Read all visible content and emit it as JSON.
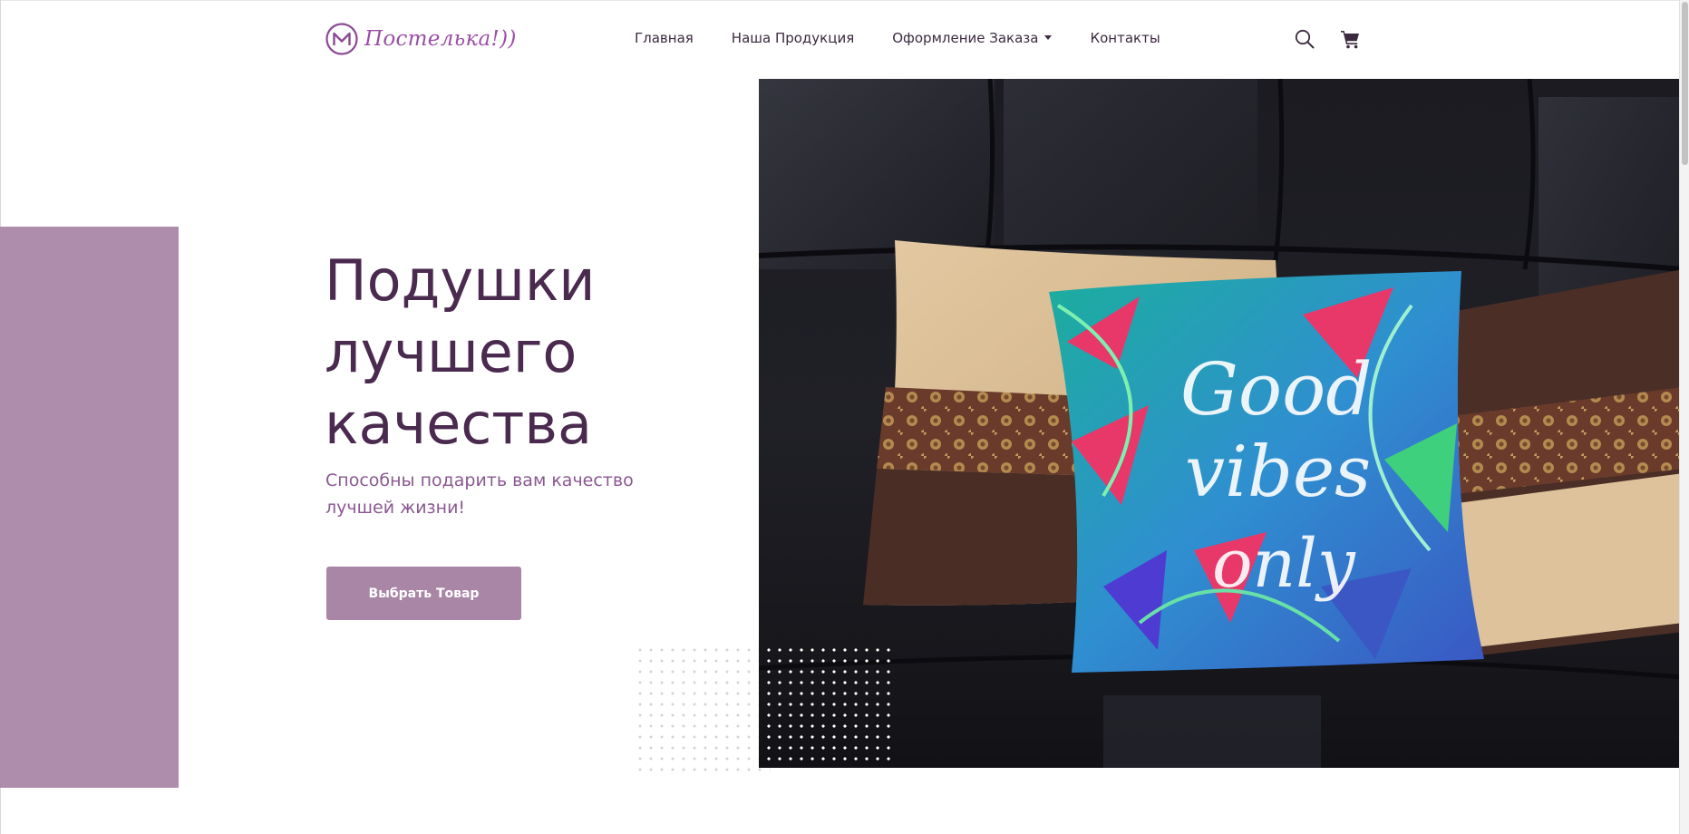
{
  "brand": {
    "name": "Постелька!))",
    "accent": "#9a4fa6"
  },
  "nav": {
    "items": [
      {
        "label": "Главная"
      },
      {
        "label": "Наша Продукция"
      },
      {
        "label": "Оформление Заказа",
        "dropdown": true
      },
      {
        "label": "Контакты"
      }
    ]
  },
  "header_icons": {
    "search": "search-icon",
    "cart": "cart-icon"
  },
  "hero": {
    "title_lines": [
      "Подушки",
      "лучшего",
      "качества"
    ],
    "subtitle": "Способны подарить вам качество лучшей жизни!",
    "cta_label": "Выбрать Товар",
    "pillow_print_text": "Good vibes only"
  },
  "colors": {
    "title": "#4a2a4e",
    "subtitle": "#8a5891",
    "block": "#ae8cab",
    "button": "#a985a6"
  }
}
